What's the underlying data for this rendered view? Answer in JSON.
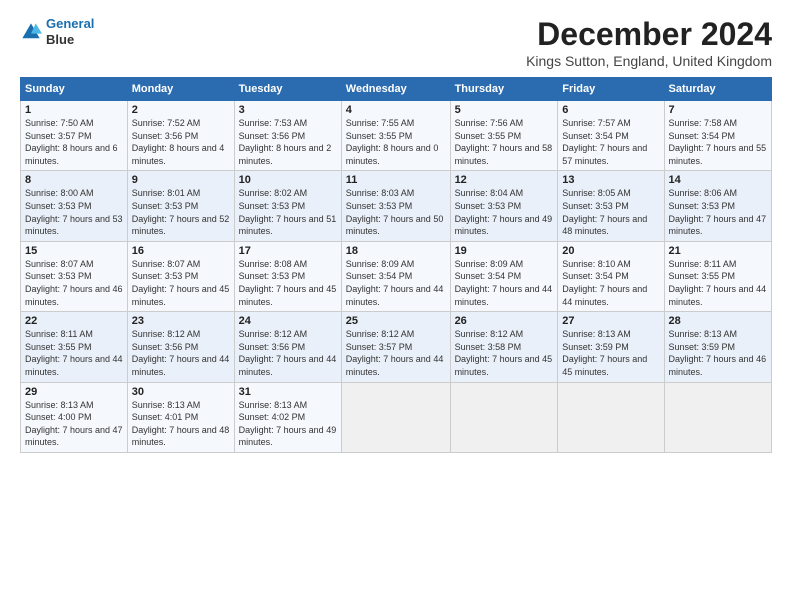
{
  "header": {
    "logo_line1": "General",
    "logo_line2": "Blue",
    "title": "December 2024",
    "subtitle": "Kings Sutton, England, United Kingdom"
  },
  "calendar": {
    "days_of_week": [
      "Sunday",
      "Monday",
      "Tuesday",
      "Wednesday",
      "Thursday",
      "Friday",
      "Saturday"
    ],
    "weeks": [
      [
        {
          "day": "1",
          "sunrise": "7:50 AM",
          "sunset": "3:57 PM",
          "daylight": "8 hours and 6 minutes."
        },
        {
          "day": "2",
          "sunrise": "7:52 AM",
          "sunset": "3:56 PM",
          "daylight": "8 hours and 4 minutes."
        },
        {
          "day": "3",
          "sunrise": "7:53 AM",
          "sunset": "3:56 PM",
          "daylight": "8 hours and 2 minutes."
        },
        {
          "day": "4",
          "sunrise": "7:55 AM",
          "sunset": "3:55 PM",
          "daylight": "8 hours and 0 minutes."
        },
        {
          "day": "5",
          "sunrise": "7:56 AM",
          "sunset": "3:55 PM",
          "daylight": "7 hours and 58 minutes."
        },
        {
          "day": "6",
          "sunrise": "7:57 AM",
          "sunset": "3:54 PM",
          "daylight": "7 hours and 57 minutes."
        },
        {
          "day": "7",
          "sunrise": "7:58 AM",
          "sunset": "3:54 PM",
          "daylight": "7 hours and 55 minutes."
        }
      ],
      [
        {
          "day": "8",
          "sunrise": "8:00 AM",
          "sunset": "3:53 PM",
          "daylight": "7 hours and 53 minutes."
        },
        {
          "day": "9",
          "sunrise": "8:01 AM",
          "sunset": "3:53 PM",
          "daylight": "7 hours and 52 minutes."
        },
        {
          "day": "10",
          "sunrise": "8:02 AM",
          "sunset": "3:53 PM",
          "daylight": "7 hours and 51 minutes."
        },
        {
          "day": "11",
          "sunrise": "8:03 AM",
          "sunset": "3:53 PM",
          "daylight": "7 hours and 50 minutes."
        },
        {
          "day": "12",
          "sunrise": "8:04 AM",
          "sunset": "3:53 PM",
          "daylight": "7 hours and 49 minutes."
        },
        {
          "day": "13",
          "sunrise": "8:05 AM",
          "sunset": "3:53 PM",
          "daylight": "7 hours and 48 minutes."
        },
        {
          "day": "14",
          "sunrise": "8:06 AM",
          "sunset": "3:53 PM",
          "daylight": "7 hours and 47 minutes."
        }
      ],
      [
        {
          "day": "15",
          "sunrise": "8:07 AM",
          "sunset": "3:53 PM",
          "daylight": "7 hours and 46 minutes."
        },
        {
          "day": "16",
          "sunrise": "8:07 AM",
          "sunset": "3:53 PM",
          "daylight": "7 hours and 45 minutes."
        },
        {
          "day": "17",
          "sunrise": "8:08 AM",
          "sunset": "3:53 PM",
          "daylight": "7 hours and 45 minutes."
        },
        {
          "day": "18",
          "sunrise": "8:09 AM",
          "sunset": "3:54 PM",
          "daylight": "7 hours and 44 minutes."
        },
        {
          "day": "19",
          "sunrise": "8:09 AM",
          "sunset": "3:54 PM",
          "daylight": "7 hours and 44 minutes."
        },
        {
          "day": "20",
          "sunrise": "8:10 AM",
          "sunset": "3:54 PM",
          "daylight": "7 hours and 44 minutes."
        },
        {
          "day": "21",
          "sunrise": "8:11 AM",
          "sunset": "3:55 PM",
          "daylight": "7 hours and 44 minutes."
        }
      ],
      [
        {
          "day": "22",
          "sunrise": "8:11 AM",
          "sunset": "3:55 PM",
          "daylight": "7 hours and 44 minutes."
        },
        {
          "day": "23",
          "sunrise": "8:12 AM",
          "sunset": "3:56 PM",
          "daylight": "7 hours and 44 minutes."
        },
        {
          "day": "24",
          "sunrise": "8:12 AM",
          "sunset": "3:56 PM",
          "daylight": "7 hours and 44 minutes."
        },
        {
          "day": "25",
          "sunrise": "8:12 AM",
          "sunset": "3:57 PM",
          "daylight": "7 hours and 44 minutes."
        },
        {
          "day": "26",
          "sunrise": "8:12 AM",
          "sunset": "3:58 PM",
          "daylight": "7 hours and 45 minutes."
        },
        {
          "day": "27",
          "sunrise": "8:13 AM",
          "sunset": "3:59 PM",
          "daylight": "7 hours and 45 minutes."
        },
        {
          "day": "28",
          "sunrise": "8:13 AM",
          "sunset": "3:59 PM",
          "daylight": "7 hours and 46 minutes."
        }
      ],
      [
        {
          "day": "29",
          "sunrise": "8:13 AM",
          "sunset": "4:00 PM",
          "daylight": "7 hours and 47 minutes."
        },
        {
          "day": "30",
          "sunrise": "8:13 AM",
          "sunset": "4:01 PM",
          "daylight": "7 hours and 48 minutes."
        },
        {
          "day": "31",
          "sunrise": "8:13 AM",
          "sunset": "4:02 PM",
          "daylight": "7 hours and 49 minutes."
        },
        null,
        null,
        null,
        null
      ]
    ]
  }
}
